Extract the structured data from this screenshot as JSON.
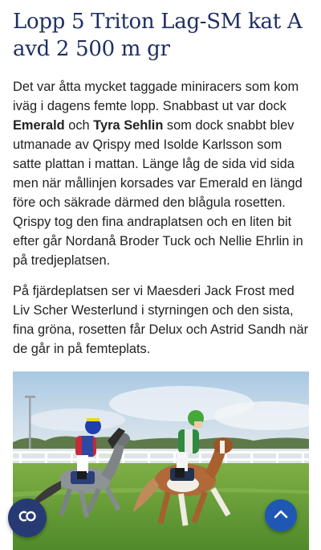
{
  "article": {
    "title": "Lopp 5 Triton Lag-SM kat A avd 2 500 m gr",
    "p1": {
      "t1": "Det var åtta mycket taggade miniracers som kom iväg i dagens femte lopp. Snabbast ut var dock ",
      "b1": "Emerald",
      "t2": " och ",
      "b2": "Tyra Sehlin",
      "t3": " som dock snabbt blev utmanade av Qrispy med Isolde Karlsson som satte plattan i mattan. Länge låg de sida vid sida men när mållinjen korsades var Emerald en längd före och säkrade därmed den blågula rosetten. Qrispy tog den fina andraplatsen och en liten bit efter går Nordanå Broder Tuck och Nellie Ehrlin in på tredjeplatsen."
    },
    "p2": "På fjärdeplatsen ser vi Maesderi Jack Frost med Liv Scher Westerlund i styrningen och den sista, fina gröna, rosetten får Delux och Astrid Sandh när de går in på femteplats."
  },
  "colors": {
    "title": "#1f2f63",
    "fab_left": "#273a74",
    "fab_right": "#1f58b4"
  },
  "icons": {
    "left_fab": "co-logo-icon",
    "right_fab": "chevron-up-icon"
  }
}
